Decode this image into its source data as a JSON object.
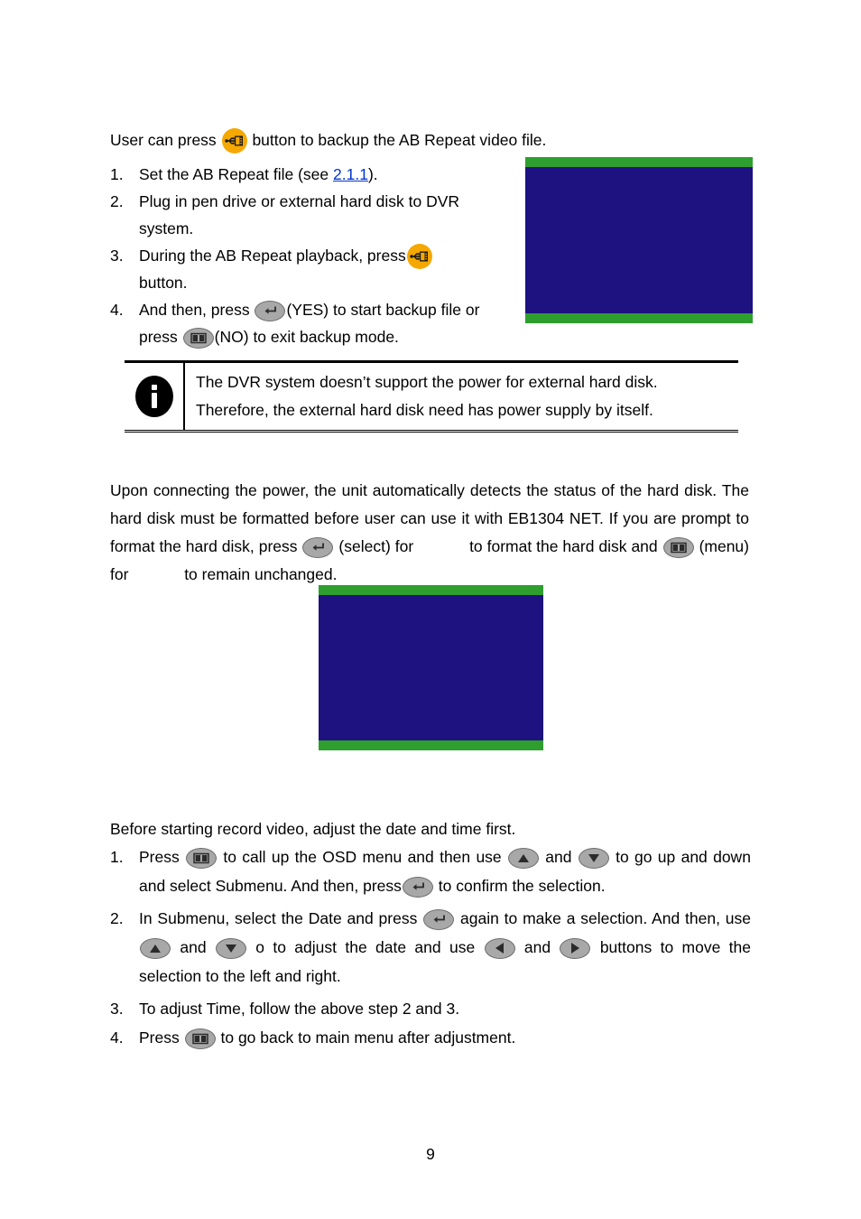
{
  "document": {
    "page_number": "9",
    "colors": {
      "screenshot_band": "#2e9e2e",
      "screenshot_body": "#1d1280",
      "usb_button": "#f5a800",
      "hardware_button": "#a8a8a8",
      "hyperlink": "#0033cc"
    }
  },
  "backup_section": {
    "intro_before": "User can press",
    "intro_after": "button to backup the AB Repeat video file.",
    "steps": [
      {
        "num": "1.",
        "text_before": "Set the AB Repeat file (see",
        "link": "2.1.1",
        "text_after": ")."
      },
      {
        "num": "2.",
        "text_before": "Plug in pen drive or external hard disk to DVR system.",
        "link": "",
        "text_after": ""
      },
      {
        "num": "3.",
        "text_before": "During the AB Repeat playback, press",
        "link": "",
        "text_after": "button."
      },
      {
        "num": "4.",
        "text_before": "And then, press",
        "mid1": "(YES) to start backup file or press",
        "text_after": "(NO) to exit backup mode."
      }
    ]
  },
  "note": {
    "line1": "The DVR system doesn’t support the power for external hard disk.",
    "line2": "Therefore, the external hard disk need has power supply by itself.",
    "icon_label": "i"
  },
  "hdd_section": {
    "paragraph_part1": "Upon connecting the power, the unit automatically detects the status of the hard disk. The hard disk must be formatted before user can use it with EB1304 NET. If you are prompt to format the hard disk, press",
    "paragraph_part2": "(select) for",
    "paragraph_part3": "to format the hard disk and",
    "paragraph_part4": "(menu) for",
    "paragraph_part5": "to remain unchanged."
  },
  "datetime_section": {
    "intro": "Before starting record video, adjust the date and time first.",
    "steps": [
      {
        "num": "1.",
        "seg1": "Press",
        "seg2": "to call up the OSD menu and then use",
        "seg3": "and",
        "seg4": "to go up and down and select Submenu. And then, press",
        "seg5": "to confirm the selection."
      },
      {
        "num": "2.",
        "seg1": "In Submenu, select the Date and press",
        "seg2": "again to make a selection. And then, use",
        "seg3": "and",
        "seg4": "o to adjust the date and use",
        "seg5": "and",
        "seg6": "buttons to move the selection to the left and right."
      },
      {
        "num": "3.",
        "seg1": "To adjust Time, follow the above step 2 and 3."
      },
      {
        "num": "4.",
        "seg1": "Press",
        "seg2": "to go back to main menu after adjustment."
      }
    ]
  },
  "icons": {
    "usb_backup": "usb-backup-icon",
    "enter_select": "enter-select-icon",
    "menu_book": "menu-book-icon",
    "arrow_up": "arrow-up-icon",
    "arrow_down": "arrow-down-icon",
    "arrow_left": "arrow-left-icon",
    "arrow_right": "arrow-right-icon",
    "info": "info-icon"
  },
  "screenshots": [
    {
      "name": "backup-confirm-screenshot"
    },
    {
      "name": "format-hdd-screenshot"
    }
  ]
}
